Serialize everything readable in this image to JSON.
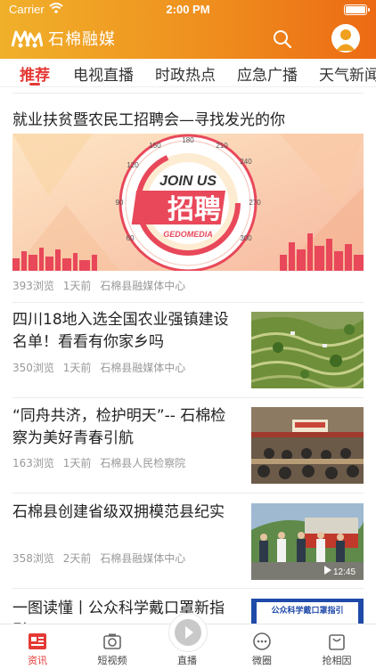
{
  "status_bar": {
    "carrier": "Carrier",
    "time": "2:00 PM"
  },
  "app": {
    "brand": "石棉融媒"
  },
  "tabs": [
    {
      "label": "推荐",
      "active": true
    },
    {
      "label": "电视直播"
    },
    {
      "label": "时政热点"
    },
    {
      "label": "应急广播"
    },
    {
      "label": "天气新闻"
    }
  ],
  "featured": {
    "title": "就业扶贫暨农民工招聘会—寻找发光的你",
    "banner": {
      "top_text": "JOIN US",
      "main_text": "招聘",
      "sub_text": "GEDOMEDIA",
      "dial_numbers": [
        "90",
        "120",
        "150",
        "180",
        "210",
        "240",
        "270",
        "300",
        "60"
      ]
    },
    "views": "393浏览",
    "time": "1天前",
    "source": "石棉县融媒体中心"
  },
  "news": [
    {
      "title": "四川18地入选全国农业强镇建设名单！看看有你家乡吗",
      "views": "350浏览",
      "time": "1天前",
      "source": "石棉县融媒体中心",
      "thumb": "terrace-fields"
    },
    {
      "title": "“同舟共济，检护明天”-- 石棉检察为美好青春引航",
      "views": "163浏览",
      "time": "1天前",
      "source": "石棉县人民检察院",
      "thumb": "meeting-room"
    },
    {
      "title": "石棉县创建省级双拥模范县纪实",
      "views": "358浏览",
      "time": "2天前",
      "source": "石棉县融媒体中心",
      "thumb": "video-people",
      "duration": "12:45"
    },
    {
      "title": "一图读懂丨公众科学戴口罩新指引",
      "thumb": "poster",
      "thumb_text": "公众科学戴口罩指引"
    }
  ],
  "tabbar": [
    {
      "label": "资讯",
      "icon": "news-icon",
      "active": true
    },
    {
      "label": "短视频",
      "icon": "camera-icon"
    },
    {
      "label": "直播",
      "icon": "play-icon"
    },
    {
      "label": "微圈",
      "icon": "chat-icon"
    },
    {
      "label": "抢相因",
      "icon": "bag-icon"
    }
  ],
  "colors": {
    "accent": "#e53935",
    "header_start": "#f0b02a",
    "header_end": "#ec6a14"
  }
}
